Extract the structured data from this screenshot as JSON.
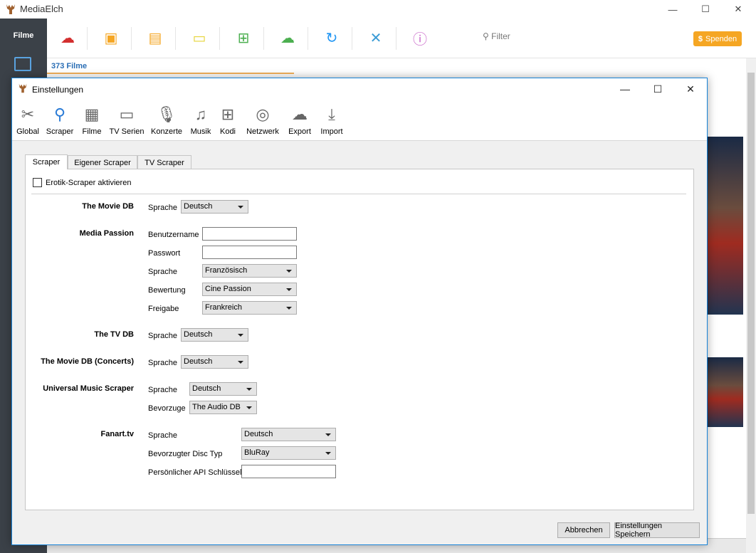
{
  "main": {
    "title": "MediaElch",
    "left_nav_label": "Filme",
    "filter_label": "Filter",
    "donate_label": "Spenden",
    "movie_count": "373 Filme"
  },
  "dialog": {
    "title": "Einstellungen",
    "categories": [
      {
        "label": "Global",
        "icon": "tools-icon"
      },
      {
        "label": "Scraper",
        "icon": "search-icon"
      },
      {
        "label": "Filme",
        "icon": "film-icon"
      },
      {
        "label": "TV Serien",
        "icon": "tv-icon"
      },
      {
        "label": "Konzerte",
        "icon": "microphone-icon"
      },
      {
        "label": "Musik",
        "icon": "music-note-icon"
      },
      {
        "label": "Kodi",
        "icon": "network-tree-icon"
      },
      {
        "label": "Netzwerk",
        "icon": "globe-icon"
      },
      {
        "label": "Export",
        "icon": "cloud-upload-icon"
      },
      {
        "label": "Import",
        "icon": "import-icon"
      }
    ],
    "tabs": [
      "Scraper",
      "Eigener Scraper",
      "TV Scraper"
    ],
    "erotik_label": "Erotik-Scraper aktivieren",
    "sections": {
      "tmdb": {
        "title": "The Movie DB",
        "sprache_label": "Sprache",
        "sprache": "Deutsch"
      },
      "media_passion": {
        "title": "Media Passion",
        "benutzername_label": "Benutzername",
        "benutzername": "",
        "passwort_label": "Passwort",
        "passwort": "",
        "sprache_label": "Sprache",
        "sprache": "Französisch",
        "bewertung_label": "Bewertung",
        "bewertung": "Cine Passion",
        "freigabe_label": "Freigabe",
        "freigabe": "Frankreich"
      },
      "tvdb": {
        "title": "The TV DB",
        "sprache_label": "Sprache",
        "sprache": "Deutsch"
      },
      "tmdb_concerts": {
        "title": "The Movie DB (Concerts)",
        "sprache_label": "Sprache",
        "sprache": "Deutsch"
      },
      "universal_music": {
        "title": "Universal Music Scraper",
        "sprache_label": "Sprache",
        "sprache": "Deutsch",
        "bevorzuge_label": "Bevorzuge",
        "bevorzuge": "The Audio DB"
      },
      "fanart": {
        "title": "Fanart.tv",
        "sprache_label": "Sprache",
        "sprache": "Deutsch",
        "disc_label": "Bevorzugter Disc Typ",
        "disc": "BluRay",
        "api_label": "Persönlicher API Schlüssel",
        "api": ""
      }
    },
    "buttons": {
      "cancel": "Abbrechen",
      "save": "Einstellungen Speichern"
    }
  }
}
